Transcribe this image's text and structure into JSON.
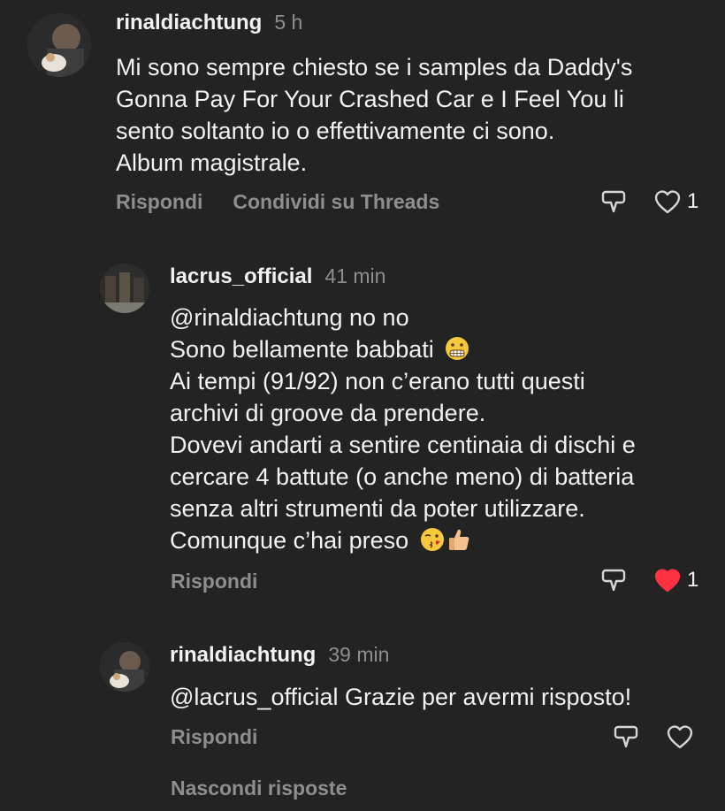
{
  "comments": [
    {
      "username": "rinaldiachtung",
      "time": "5 h",
      "text": "Mi sono sempre chiesto se i samples da Daddy's\nGonna Pay For Your Crashed Car e I Feel You li\nsento soltanto io o effettivamente ci sono.\nAlbum magistrale.",
      "reply_label": "Rispondi",
      "share_label": "Condividi su Threads",
      "like_count": "1",
      "liked": false
    },
    {
      "username": "lacrus_official",
      "time": "41 min",
      "lines": [
        "@rinaldiachtung no no",
        "Sono bellamente babbati",
        "Ai tempi (91/92) non c’erano tutti questi",
        "archivi di groove da prendere.",
        "Dovevi andarti a sentire centinaia di dischi e",
        "cercare 4 battute (o anche meno) di batteria",
        "senza altri strumenti da poter utilizzare.",
        "Comunque c’hai preso"
      ],
      "emojis": [
        "grimacing-face-emoji",
        "kissing-winking-face-emoji",
        "thumbs-up-emoji"
      ],
      "reply_label": "Rispondi",
      "like_count": "1",
      "liked": true
    },
    {
      "username": "rinaldiachtung",
      "time": "39 min",
      "text": "@lacrus_official Grazie per avermi risposto!",
      "reply_label": "Rispondi",
      "liked": false
    }
  ],
  "hide_replies_label": "Nascondi risposte",
  "colors": {
    "background": "#232323",
    "text": "#f2f2f2",
    "muted": "#8e8e8e",
    "like_red": "#ff3040"
  }
}
